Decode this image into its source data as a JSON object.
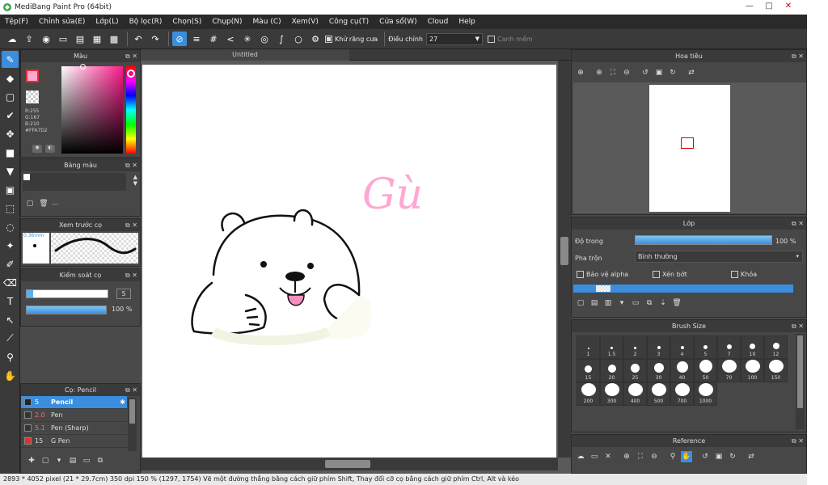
{
  "window": {
    "title": "MediBang Paint Pro (64bit)",
    "minimize": "—",
    "maximize": "□",
    "close": "✕"
  },
  "menu": [
    "Tệp(F)",
    "Chỉnh sửa(E)",
    "Lớp(L)",
    "Bộ lọc(R)",
    "Chọn(S)",
    "Chụp(N)",
    "Màu (C)",
    "Xem(V)",
    "Công cụ(T)",
    "Cửa sổ(W)",
    "Cloud",
    "Help"
  ],
  "toolbar": {
    "antialias_label": "Khử răng cưa",
    "adjust_label": "Điều chỉnh",
    "adjust_value": "27",
    "smooth_label": "Canh mềm"
  },
  "color_panel": {
    "title": "Màu",
    "r": "R:255",
    "g": "G:167",
    "b": "B:210",
    "hex": "#FFA7D2",
    "primary": "#ffa7d2"
  },
  "palette_panel": {
    "title": "Bảng màu",
    "dash": "—"
  },
  "brush_preview": {
    "title": "Xem trước cọ",
    "size": "0.36mm"
  },
  "brush_control": {
    "title": "Kiểm soát cọ",
    "size": "5",
    "opacity": "100 %"
  },
  "brush_list": {
    "title": "Cọ: Pencil",
    "items": [
      {
        "size": "5",
        "name": "Pencil",
        "color": "#222222",
        "selected": true
      },
      {
        "size": "2.0",
        "name": "Pen",
        "color": "#333333",
        "selected": false
      },
      {
        "size": "5.1",
        "name": "Pen (Sharp)",
        "color": "#333333",
        "selected": false
      },
      {
        "size": "15",
        "name": "G Pen",
        "color": "#e03030",
        "selected": false
      }
    ]
  },
  "canvas": {
    "tab": "Untitled",
    "text": "Gù"
  },
  "navigator": {
    "title": "Hoa tiêu"
  },
  "layer_panel": {
    "title": "Lớp",
    "opacity_label": "Độ trong",
    "opacity_value": "100 %",
    "opacity_fraction": 1.0,
    "blend_label": "Pha trộn",
    "blend_value": "Bình thường",
    "protect_alpha": "Bảo vệ alpha",
    "clipping": "Xén bớt",
    "lock": "Khóa"
  },
  "brush_size_panel": {
    "title": "Brush Size",
    "sizes": [
      "1",
      "1.5",
      "2",
      "3",
      "4",
      "5",
      "7",
      "10",
      "12",
      "15",
      "20",
      "25",
      "30",
      "40",
      "50",
      "70",
      "100",
      "150",
      "200",
      "300",
      "400",
      "500",
      "700",
      "1000"
    ]
  },
  "reference_panel": {
    "title": "Reference"
  },
  "status": "2893 * 4052 pixel  (21 * 29.7cm)  350 dpi  150 %  (1297, 1754)  Vẽ một đường thẳng bằng cách giữ phím Shift, Thay đổi cỡ cọ bằng cách giữ phím Ctrl, Alt và kéo"
}
